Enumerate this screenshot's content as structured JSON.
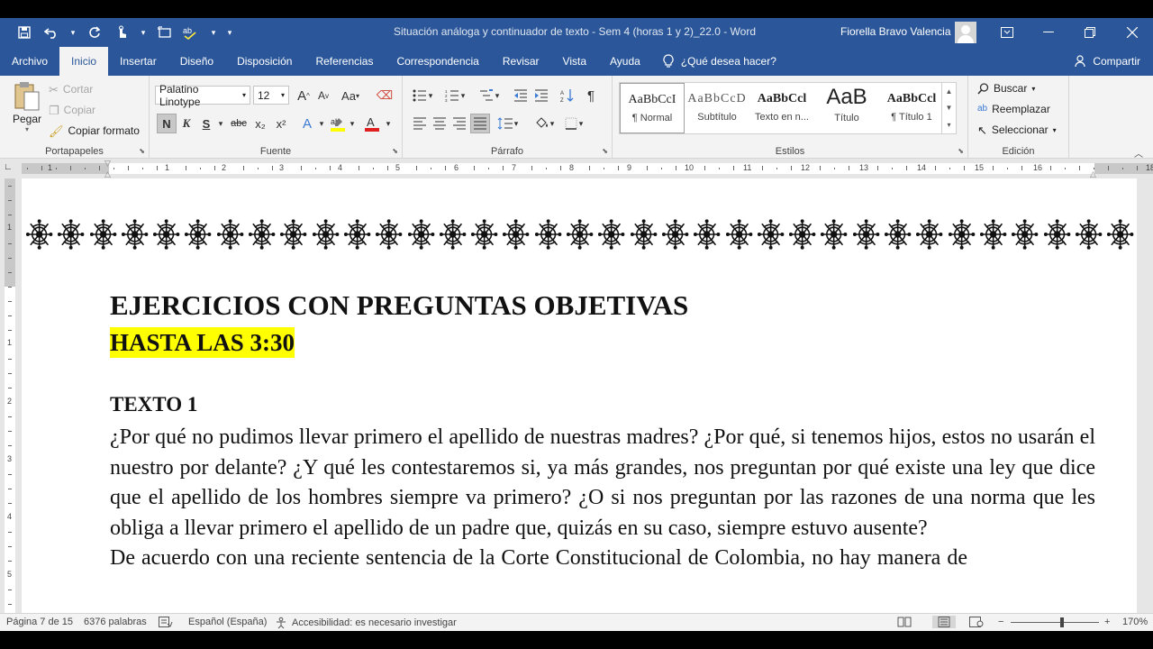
{
  "window": {
    "title": "Situación análoga y continuador de texto - Sem 4 (horas 1 y 2)_22.0  -  Word",
    "user": "Fiorella Bravo Valencia",
    "colors": {
      "accent": "#2b579a",
      "highlight": "#ffff00",
      "ribbon": "#f3f3f3"
    }
  },
  "qat": {
    "icons": [
      "save-icon",
      "undo-icon",
      "redo-icon",
      "touch-mode-icon",
      "screenshot-icon",
      "spelling-icon",
      "customize-icon"
    ]
  },
  "tabs": [
    {
      "label": "Archivo"
    },
    {
      "label": "Inicio",
      "active": true
    },
    {
      "label": "Insertar"
    },
    {
      "label": "Diseño"
    },
    {
      "label": "Disposición"
    },
    {
      "label": "Referencias"
    },
    {
      "label": "Correspondencia"
    },
    {
      "label": "Revisar"
    },
    {
      "label": "Vista"
    },
    {
      "label": "Ayuda"
    }
  ],
  "tellme": "¿Qué desea hacer?",
  "share": "Compartir",
  "ribbon": {
    "clipboard": {
      "paste": "Pegar",
      "cut": "Cortar",
      "copy": "Copiar",
      "format_painter": "Copiar formato",
      "label": "Portapapeles"
    },
    "font": {
      "family": "Palatino Linotype",
      "size": "12",
      "bold": "N",
      "italic": "K",
      "underline": "S",
      "strike": "abc",
      "subscript": "x₂",
      "superscript": "x²",
      "grow": "A",
      "shrink": "A",
      "case": "Aa",
      "text_effects": "A",
      "font_color": "A",
      "label": "Fuente"
    },
    "paragraph": {
      "label": "Párrafo"
    },
    "styles": {
      "label": "Estilos",
      "items": [
        {
          "sample": "AaBbCcI",
          "name": "¶ Normal"
        },
        {
          "sample": "AaBbCcD",
          "name": "Subtítulo"
        },
        {
          "sample": "AaBbCcl",
          "name": "Texto en n..."
        },
        {
          "sample": "AaB",
          "name": "Título"
        },
        {
          "sample": "AaBbCcl",
          "name": "¶ Título 1"
        }
      ]
    },
    "editing": {
      "find": "Buscar",
      "replace": "Reemplazar",
      "select": "Seleccionar",
      "label": "Edición"
    }
  },
  "ruler": {
    "h_numbers": [
      "1",
      "1",
      "2",
      "3",
      "4",
      "5",
      "6",
      "7",
      "8",
      "9",
      "10",
      "11",
      "12",
      "13",
      "14",
      "15",
      "16",
      "18"
    ],
    "v_numbers": [
      "1",
      "1",
      "2",
      "3",
      "4",
      "5"
    ]
  },
  "document": {
    "title": "EJERCICIOS CON PREGUNTAS OBJETIVAS",
    "subtitle": "HASTA LAS 3:30",
    "section": "TEXTO 1",
    "paragraph1": "¿Por qué no pudimos llevar primero el apellido de nuestras madres? ¿Por qué, si tenemos hijos, estos no usarán el nuestro por delante? ¿Y qué les contestaremos si, ya más grandes, nos preguntan por qué existe una ley que dice que el apellido de los hombres siempre va primero? ¿O si nos preguntan por las razones de una norma que les obliga a llevar primero el apellido de un padre que, quizás en su caso, siempre estuvo ausente?",
    "paragraph2": "De acuerdo con una reciente sentencia de la Corte Constitucional de Colombia, no hay manera de"
  },
  "status": {
    "page": "Página 7 de 15",
    "words": "6376 palabras",
    "language": "Español (España)",
    "accessibility": "Accesibilidad: es necesario investigar",
    "zoom": "170%",
    "zoom_minus": "−",
    "zoom_plus": "+"
  }
}
